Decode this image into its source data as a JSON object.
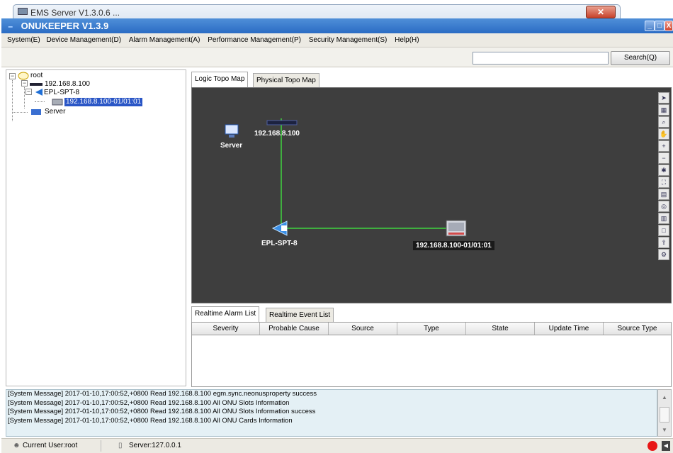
{
  "background_window": {
    "title": "EMS Server V1.3.0.6 ..."
  },
  "window": {
    "title": "ONUKEEPER V1.3.9",
    "controls": [
      "_",
      "□",
      "X"
    ]
  },
  "menu": [
    "System(E)",
    "Device Management(D)",
    "Alarm Management(A)",
    "Performance Management(P)",
    "Security Management(S)",
    "Help(H)"
  ],
  "search": {
    "value": "",
    "button_label": "Search(Q)"
  },
  "tree": {
    "root": "root",
    "olt": "192.168.8.100",
    "switch": "EPL-SPT-8",
    "onu": "192.168.8.100-01/01:01",
    "server": "Server"
  },
  "tabs": {
    "logic": "Logic Topo Map",
    "physical": "Physical Topo Map"
  },
  "topo": {
    "server_label": "Server",
    "olt_label": "192.168.8.100",
    "switch_label": "EPL-SPT-8",
    "onu_label": "192.168.8.100-01/01:01",
    "link_color": "#3fae3f"
  },
  "side_tools": [
    "select-icon",
    "grid-icon",
    "zoom-icon",
    "hand-icon",
    "zoom-in-icon",
    "zoom-out-icon",
    "fit-icon",
    "fullscreen-icon",
    "layout-icon",
    "zoom-area-icon",
    "properties-icon",
    "frame-icon",
    "export-icon",
    "settings-icon"
  ],
  "alarm_tabs": {
    "realtime_alarm": "Realtime Alarm List",
    "realtime_event": "Realtime Event List"
  },
  "alarm_columns": [
    "Severity",
    "Probable Cause",
    "Source",
    "Type",
    "State",
    "Update Time",
    "Source Type"
  ],
  "messages": [
    "[System Message]  2017-01-10,17:00:52,+0800 Read 192.168.8.100 egm.sync.neonusproperty success",
    "[System Message]  2017-01-10,17:00:52,+0800 Read 192.168.8.100 All ONU Slots Information",
    "[System Message]  2017-01-10,17:00:52,+0800 Read 192.168.8.100 All ONU Slots Information success",
    "[System Message]  2017-01-10,17:00:52,+0800 Read 192.168.8.100 All ONU Cards Information"
  ],
  "status": {
    "current_user": "Current User:root",
    "server": "Server:127.0.0.1"
  },
  "colors": {
    "title_blue": "#2b6cc4",
    "canvas": "#3e3e3e",
    "selection": "#2a56c6",
    "alarm_red": "#e81616"
  }
}
